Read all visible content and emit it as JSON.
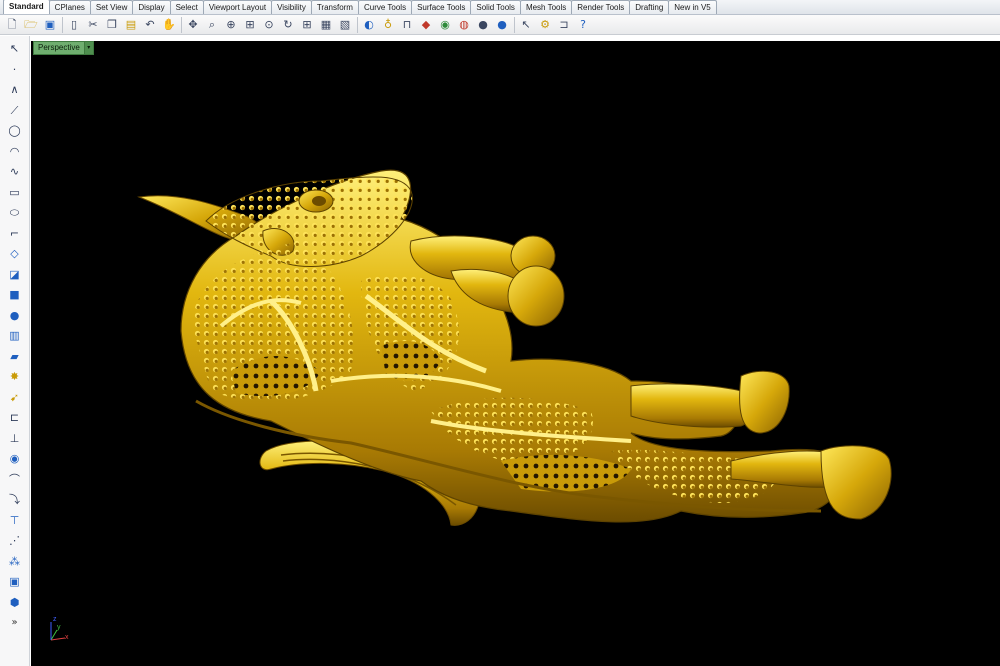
{
  "tabs": [
    "Standard",
    "CPlanes",
    "Set View",
    "Display",
    "Select",
    "Viewport Layout",
    "Visibility",
    "Transform",
    "Curve Tools",
    "Surface Tools",
    "Solid Tools",
    "Mesh Tools",
    "Render Tools",
    "Drafting",
    "New in V5"
  ],
  "active_tab": "Standard",
  "toolbar_icons": [
    "new-file",
    "open-file",
    "save-file",
    "new-document",
    "cut",
    "copy",
    "paste",
    "undo",
    "pan-hand",
    "rotate-view",
    "zoom-window",
    "zoom-in",
    "zoom-extents",
    "zoom-selected",
    "rotate-3d",
    "four-viewports",
    "grid",
    "named-views",
    "display-mode",
    "light",
    "lock",
    "layer",
    "color-wheel",
    "render",
    "shaded",
    "sphere",
    "settings-gear",
    "toggle",
    "help"
  ],
  "left_toolbar_icons": [
    "select-arrow",
    "point",
    "polyline",
    "line",
    "circle",
    "arc",
    "curve",
    "rectangle",
    "ellipse",
    "fillet",
    "dimension",
    "surface",
    "box",
    "sphere",
    "cylinder",
    "extrude",
    "explode",
    "transform",
    "boolean",
    "mirror",
    "join",
    "trim",
    "split",
    "offset",
    "rebuild",
    "text",
    "block",
    "solid"
  ],
  "viewport": {
    "title": "Perspective",
    "menu_arrow": "▾",
    "background": "#000000",
    "object_color": "#d4a80a"
  },
  "axis": {
    "x": "x",
    "y": "y",
    "z": "z"
  },
  "more_label": "»"
}
